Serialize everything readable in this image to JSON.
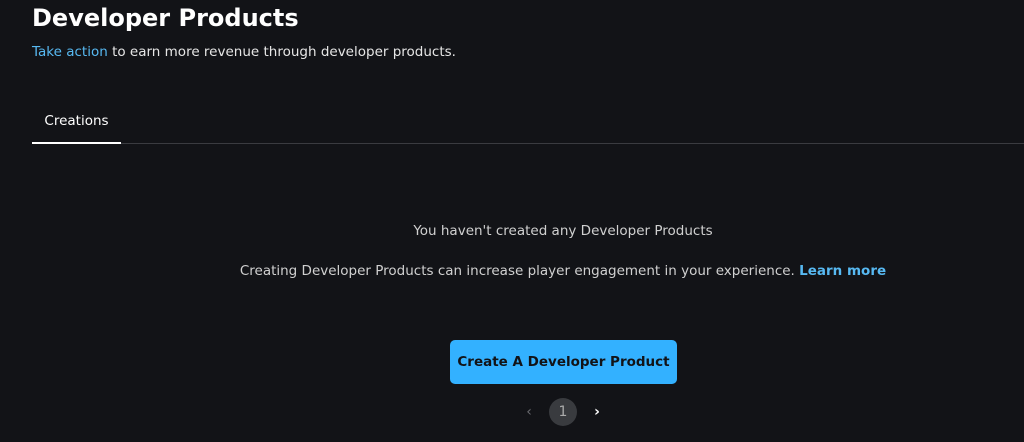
{
  "header": {
    "title": "Developer Products",
    "subtitle_link": "Take action",
    "subtitle_rest": " to earn more revenue through developer products."
  },
  "tabs": [
    {
      "label": "Creations",
      "active": true
    }
  ],
  "empty_state": {
    "heading": "You haven't created any Developer Products",
    "body": "Creating Developer Products can increase player engagement in your experience. ",
    "learn_more": "Learn more"
  },
  "create_button": "Create A Developer Product",
  "pagination": {
    "prev": "‹",
    "current": "1",
    "next": "›"
  },
  "colors": {
    "accent": "#33b1ff",
    "link": "#57b9f2",
    "background": "#121317"
  }
}
